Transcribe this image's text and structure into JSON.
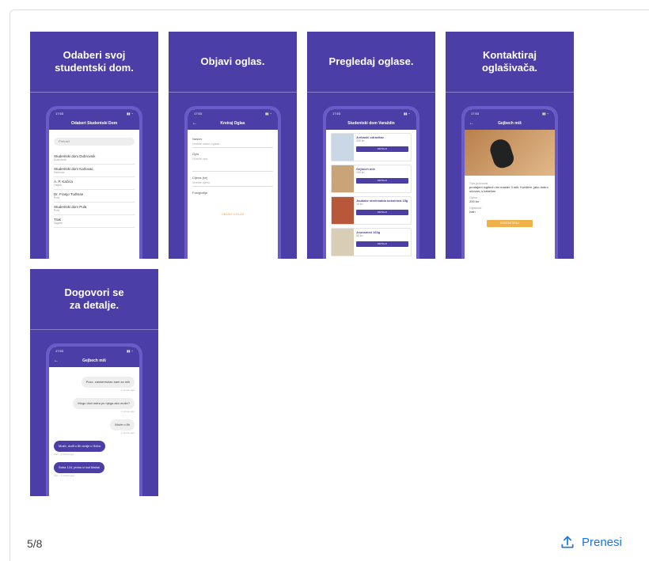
{
  "screenshots": [
    {
      "title": "Odaberi svoj\nstudentski dom.",
      "app_title": "Odaberi Studentski Dom",
      "search_placeholder": "Pretraži",
      "dorms": [
        {
          "name": "Studentski dom Dubrovnik",
          "city": "Dubrovnik"
        },
        {
          "name": "Studentski dom Karlovac",
          "city": "Karlovac"
        },
        {
          "name": "A. P. Kačića",
          "city": "Osijek"
        },
        {
          "name": "Dr. Franjo Tuđman",
          "city": "Pula"
        },
        {
          "name": "Studentski dom Pula",
          "city": "Pula"
        },
        {
          "name": "Trak",
          "city": "Zagreb"
        }
      ]
    },
    {
      "title": "Objavi oglas.",
      "app_title": "Kreiraj Oglas",
      "fields": [
        {
          "label": "Naslov",
          "placeholder": "Unesite naslov oglasa"
        },
        {
          "label": "Opis",
          "placeholder": "Unesite opis"
        },
        {
          "label": "Cijena (kn)",
          "placeholder": "Unesite cijenu"
        },
        {
          "label": "Fotografija",
          "placeholder": ""
        }
      ],
      "publish": "OBJAVI OGLAS"
    },
    {
      "title": "Pregledaj oglase.",
      "app_title": "Studentski dom Varaždin",
      "ads": [
        {
          "title": "Jurbaski zdravitav",
          "price": "200 kn",
          "button": "DETALJI"
        },
        {
          "title": "Gejbech miš",
          "price": "100 kn",
          "button": "DETALJI"
        },
        {
          "title": "Jaukake strekinakia kokoinica 15g",
          "price": "15 kn",
          "button": "DETALJI"
        },
        {
          "title": "Jounamed 160g",
          "price": "50 kn",
          "button": "DETALJI"
        }
      ]
    },
    {
      "title": "Kontaktiraj\noglašivača.",
      "app_title": "Gejbech miš",
      "desc_label": "Opis proizvoda",
      "desc": "prodajem logitech mx master 3 miš. Korišten, jako dobro očuvan, s kabelom",
      "price_label": "Cijena",
      "price": "200 kn",
      "seller_label": "Oglašivač",
      "seller": "Ivan",
      "contact": "KONTAKTIRAJ"
    },
    {
      "title": "Dogovori se\nza detalje.",
      "app_title": "Gejbech miš",
      "messages": [
        {
          "dir": "in",
          "text": "Pozz, zainteresiran sam za miš",
          "time": "1 minute ago"
        },
        {
          "dir": "in",
          "text": "Mogu doći sutra po njega ako može?",
          "time": "1 minute ago"
        },
        {
          "dir": "in",
          "text": "Može u 8h",
          "time": "1 minute ago"
        },
        {
          "dir": "out",
          "text": "Može, dođi u 8h ovdje u Sobu",
          "time": "Ivan - 1 minute ago"
        },
        {
          "dir": "out",
          "text": "Soba 124, jedno iz tad Mafaš",
          "time": "Ivan - 1 minute ago"
        }
      ]
    }
  ],
  "footer": {
    "counter": "5/8",
    "download": "Prenesi",
    "accent": "#1a73e8"
  },
  "colors": {
    "brand": "#4b3ea6",
    "accent_orange": "#f0b14a"
  }
}
